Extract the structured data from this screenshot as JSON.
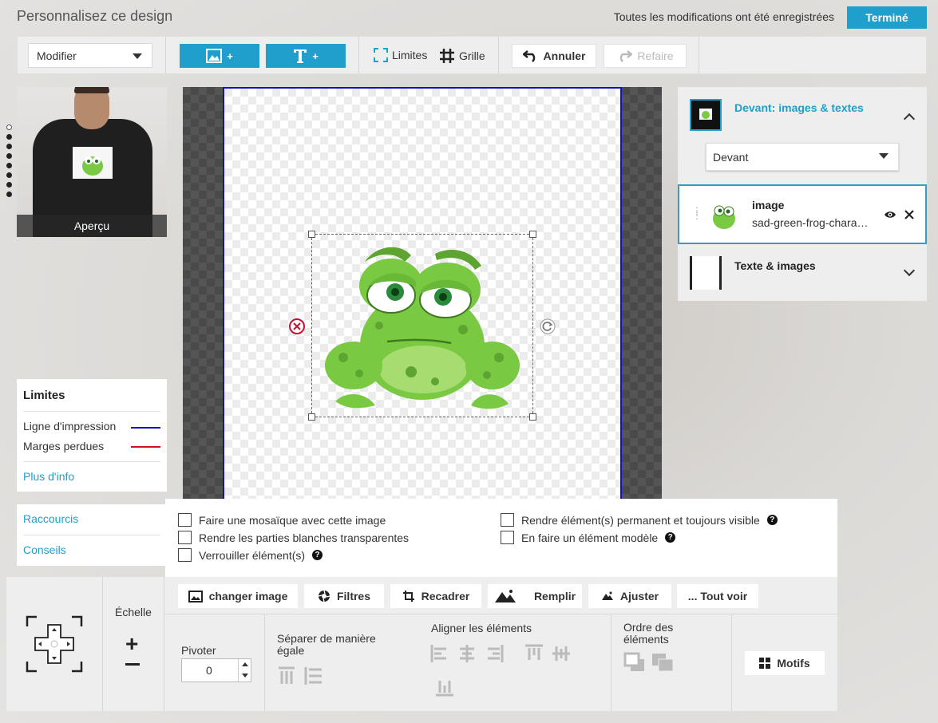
{
  "header": {
    "title": "Personnalisez ce design",
    "saved_status": "Toutes les modifications ont été enregistrées",
    "done_label": "Terminé"
  },
  "toolbar": {
    "mode_select": "Modifier",
    "add_image_label": "+",
    "add_text_label": "+",
    "limits_label": "Limites",
    "grid_label": "Grille",
    "undo_label": "Annuler",
    "redo_label": "Refaire"
  },
  "preview": {
    "label": "Aperçu"
  },
  "right_panel": {
    "section_title": "Devant: images & textes",
    "side_select": "Devant",
    "layer": {
      "name": "image",
      "file": "sad-green-frog-charac..."
    },
    "text_section": "Texte & images"
  },
  "limits": {
    "title": "Limites",
    "print_line": "Ligne d'impression",
    "bleed": "Marges perdues",
    "more_info": "Plus d'info",
    "print_line_color": "#1010cc",
    "bleed_color": "#d0101a"
  },
  "shortcuts": {
    "shortcuts": "Raccourcis",
    "tips": "Conseils"
  },
  "options": {
    "mosaic": "Faire une mosaïque avec cette image",
    "transparent": "Rendre les parties blanches transparentes",
    "lock": "Verrouiller élément(s)",
    "permanent": "Rendre élément(s) permanent et toujours visible",
    "template": "En faire un élément modèle"
  },
  "bottom": {
    "change_image": "changer image",
    "filters": "Filtres",
    "crop": "Recadrer",
    "fill": "Remplir",
    "adjust": "Ajuster",
    "see_all": "... Tout voir",
    "scale": "Échelle",
    "rotate": "Pivoter",
    "rotate_value": "0",
    "separate": "Séparer de manière égale",
    "align": "Aligner les éléments",
    "order": "Ordre des éléments",
    "motifs": "Motifs"
  },
  "colors": {
    "accent": "#1e9fcc",
    "frog_green": "#7ac943"
  }
}
